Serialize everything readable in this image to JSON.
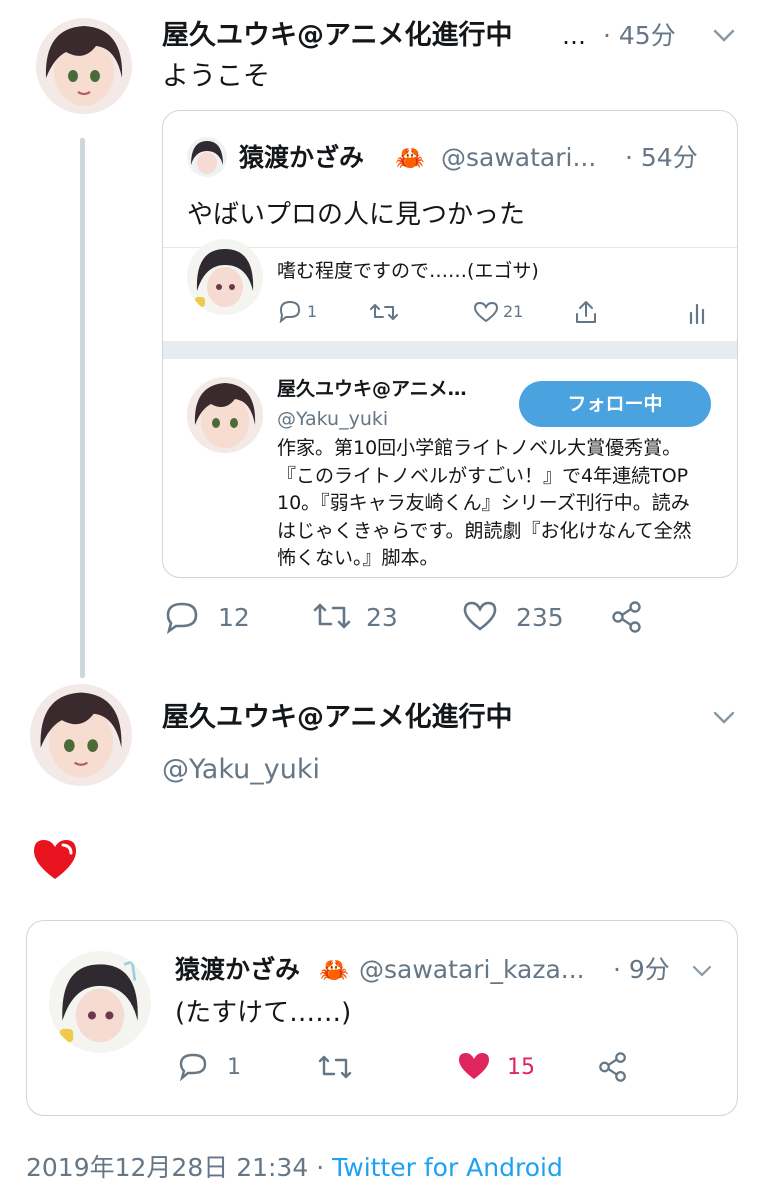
{
  "tweet1": {
    "name": "屋久ユウキ@アニメ化進行中",
    "ellipsis": "…",
    "time": "· 45分",
    "text": "ようこそ",
    "quote": {
      "name": "猿渡かざみ",
      "crab": "🦀",
      "handle": "@sawatari...",
      "time": "· 54分",
      "text": "やばいプロの人に見つかった",
      "embedded_reply": {
        "text": "嗜む程度ですので……(エゴサ)",
        "reply_count": "1",
        "like_count": "21"
      },
      "profile_card": {
        "name": "屋久ユウキ@アニメ…",
        "handle": "@Yaku_yuki",
        "follow_label": "フォロー中",
        "bio": "作家。第10回小学館ライトノベル大賞優秀賞。『このライトノベルがすごい！』で4年連続TOP10。『弱キャラ友崎くん』シリーズ刊行中。読みはじゃくきゃらです。朗読劇『お化けなんて全然怖くない。』脚本。"
      }
    },
    "reply_count": "12",
    "retweet_count": "23",
    "like_count": "235"
  },
  "main": {
    "name": "屋久ユウキ@アニメ化進行中",
    "handle": "@Yaku_yuki",
    "heart_icon": "red-heart-emoji",
    "quote": {
      "name": "猿渡かざみ",
      "crab": "🦀",
      "handle": "@sawatari_kaza...",
      "time": "· 9分",
      "text": "(たすけて……)",
      "reply_count": "1",
      "like_count": "15"
    },
    "timestamp": "2019年12月28日 21:34",
    "separator": "·",
    "client": "Twitter for Android"
  },
  "colors": {
    "accent": "#1da1f2",
    "like": "#e0245e",
    "grey": "#657786",
    "border": "#ccd6dd",
    "follow_button": "#4aa3df"
  }
}
